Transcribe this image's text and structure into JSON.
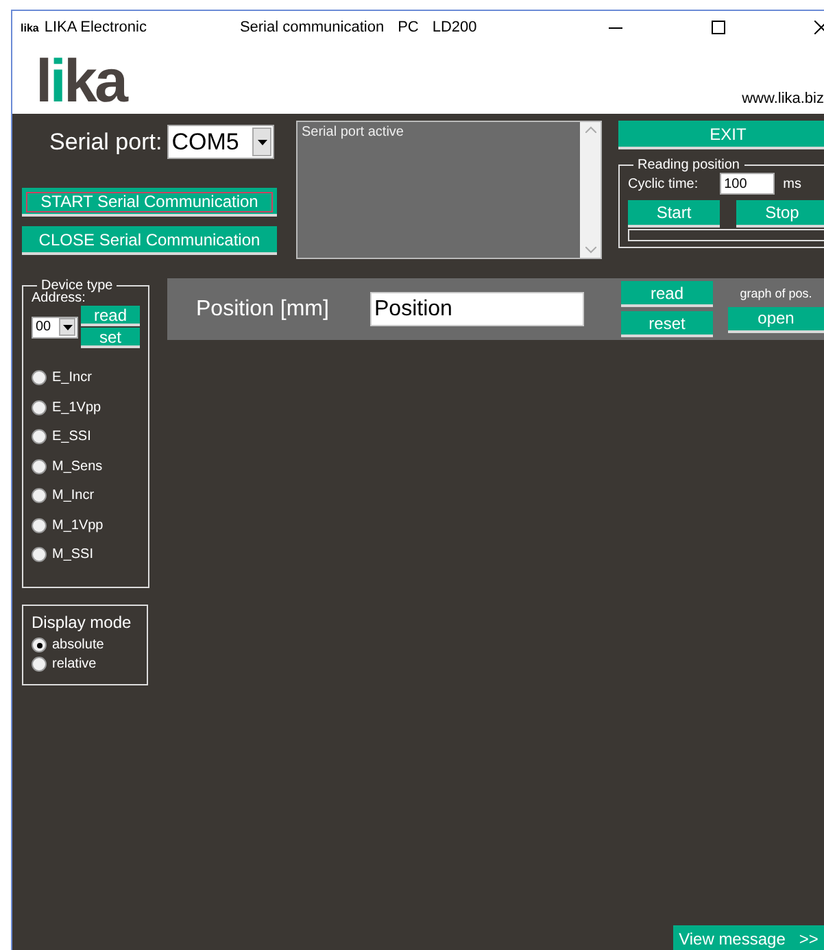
{
  "window": {
    "logo_small": "lika",
    "title": "LIKA Electronic",
    "caption": "Serial communication",
    "caption_parts": [
      "PC",
      "LD200"
    ]
  },
  "header": {
    "logo": "lika",
    "url": "www.lika.biz"
  },
  "serial_port": {
    "label": "Serial port:",
    "value": "COM5"
  },
  "buttons": [
    {
      "label": "START Serial Communication",
      "focused": true
    },
    {
      "label": "CLOSE Serial Communication",
      "focused": false
    }
  ],
  "log": {
    "text": "Serial port active"
  },
  "exit": {
    "label": "EXIT"
  },
  "reading_position": {
    "title": "Reading position",
    "cyclic_label": "Cyclic time:",
    "cyclic_value": "100",
    "unit": "ms",
    "start": "Start",
    "stop": "Stop",
    "level": 0
  },
  "device_type": {
    "title": "Device type",
    "address_label": "Address:",
    "address_value": "00",
    "read": "read",
    "set": "set",
    "options": [
      {
        "label": "E_Incr",
        "selected": false
      },
      {
        "label": "E_1Vpp",
        "selected": false
      },
      {
        "label": "E_SSI",
        "selected": false
      },
      {
        "label": "M_Sens",
        "selected": false
      },
      {
        "label": "M_Incr",
        "selected": false
      },
      {
        "label": "M_1Vpp",
        "selected": false
      },
      {
        "label": "M_SSI",
        "selected": false
      }
    ]
  },
  "display_mode": {
    "title": "Display mode",
    "options": [
      {
        "label": "absolute",
        "selected": true
      },
      {
        "label": "relative",
        "selected": false
      }
    ]
  },
  "position": {
    "label": "Position [mm]",
    "value": "Position",
    "read": "read",
    "reset": "reset",
    "graph_label": "graph of pos.",
    "open": "open"
  },
  "view_message": {
    "label": "View message",
    "arrow": ">>"
  }
}
